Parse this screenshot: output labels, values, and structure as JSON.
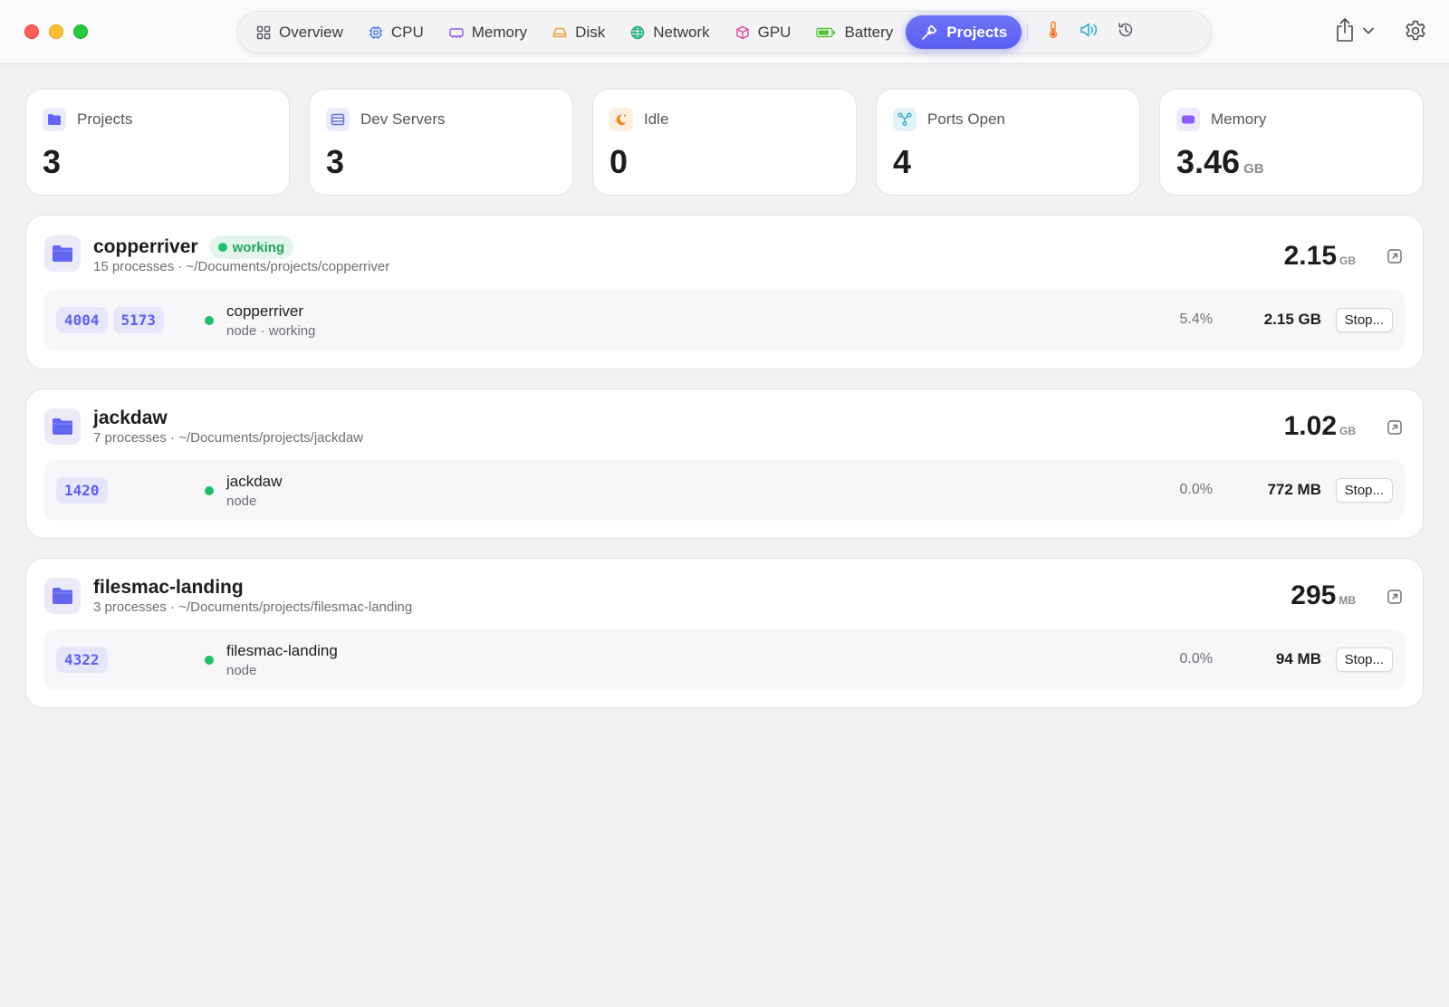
{
  "toolbar": {
    "tabs": [
      {
        "label": "Overview",
        "icon": "grid-icon",
        "color": "#5b5b63"
      },
      {
        "label": "CPU",
        "icon": "cpu-icon",
        "color": "#4f7cf2"
      },
      {
        "label": "Memory",
        "icon": "memory-icon",
        "color": "#8b5cf6"
      },
      {
        "label": "Disk",
        "icon": "disk-icon",
        "color": "#f0a030"
      },
      {
        "label": "Network",
        "icon": "globe-icon",
        "color": "#22b07d"
      },
      {
        "label": "GPU",
        "icon": "cube-icon",
        "color": "#e0429a"
      },
      {
        "label": "Battery",
        "icon": "battery-icon",
        "color": "#52c234"
      },
      {
        "label": "Projects",
        "icon": "hammer-icon",
        "color": "#ffffff"
      }
    ],
    "active_tab": "Projects",
    "extra_icons": [
      "thermometer-icon",
      "speaker-icon",
      "history-icon"
    ]
  },
  "stats": [
    {
      "label": "Projects",
      "value": "3",
      "unit": "",
      "icon": "folder-icon",
      "color": "#6366f1",
      "bg": "#ecebfc"
    },
    {
      "label": "Dev Servers",
      "value": "3",
      "unit": "",
      "icon": "server-icon",
      "color": "#5b6ee0",
      "bg": "#e9ecfb"
    },
    {
      "label": "Idle",
      "value": "0",
      "unit": "",
      "icon": "moon-icon",
      "color": "#f08a24",
      "bg": "#fdeedd"
    },
    {
      "label": "Ports Open",
      "value": "4",
      "unit": "",
      "icon": "network-icon",
      "color": "#2aa7d6",
      "bg": "#e3f3fa"
    },
    {
      "label": "Memory",
      "value": "3.46",
      "unit": "GB",
      "icon": "memory-chip-icon",
      "color": "#8b5cf6",
      "bg": "#efe9fd"
    }
  ],
  "projects": [
    {
      "name": "copperriver",
      "status": "working",
      "subtitle": "15 processes · ~/Documents/projects/copperriver",
      "size": "2.15",
      "size_unit": "GB",
      "processes": [
        {
          "ports": [
            "4004",
            "5173"
          ],
          "name": "copperriver",
          "detail": "node · working",
          "cpu": "5.4%",
          "memory": "2.15 GB",
          "stop_label": "Stop..."
        }
      ]
    },
    {
      "name": "jackdaw",
      "status": "",
      "subtitle": "7 processes · ~/Documents/projects/jackdaw",
      "size": "1.02",
      "size_unit": "GB",
      "processes": [
        {
          "ports": [
            "1420"
          ],
          "name": "jackdaw",
          "detail": "node",
          "cpu": "0.0%",
          "memory": "772 MB",
          "stop_label": "Stop..."
        }
      ]
    },
    {
      "name": "filesmac-landing",
      "status": "",
      "subtitle": "3 processes · ~/Documents/projects/filesmac-landing",
      "size": "295",
      "size_unit": "MB",
      "processes": [
        {
          "ports": [
            "4322"
          ],
          "name": "filesmac-landing",
          "detail": "node",
          "cpu": "0.0%",
          "memory": "94 MB",
          "stop_label": "Stop..."
        }
      ]
    }
  ]
}
